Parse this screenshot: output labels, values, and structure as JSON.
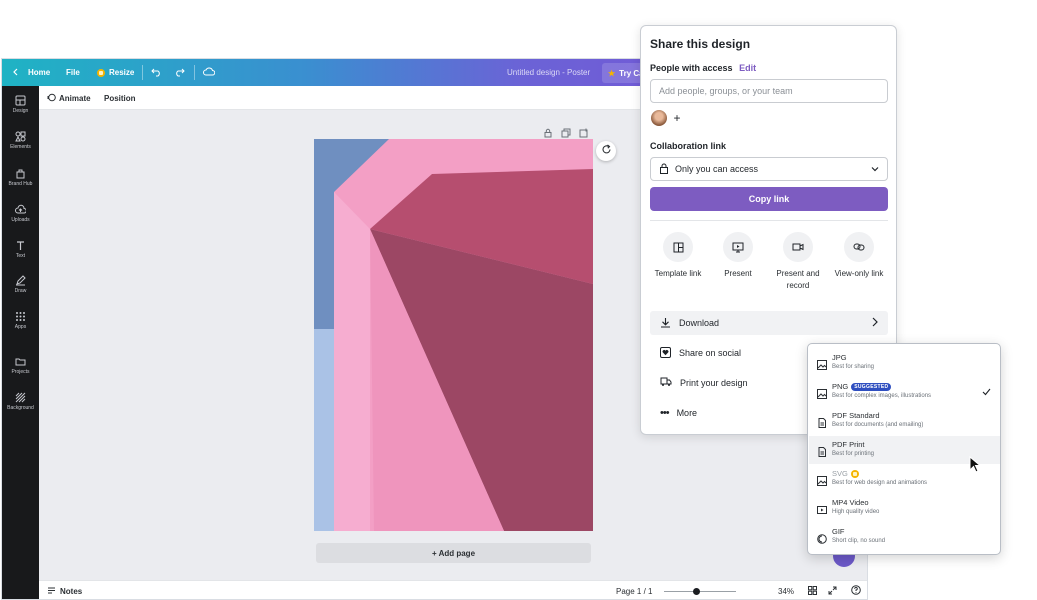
{
  "topbar": {
    "home": "Home",
    "file": "File",
    "resize": "Resize",
    "title": "Untitled design - Poster",
    "try": "Try Car"
  },
  "sidebar": {
    "items": [
      {
        "label": "Design",
        "icon": "layout-icon"
      },
      {
        "label": "Elements",
        "icon": "shapes-icon"
      },
      {
        "label": "Brand Hub",
        "icon": "brand-icon"
      },
      {
        "label": "Uploads",
        "icon": "cloud-upload-icon"
      },
      {
        "label": "Text",
        "icon": "text-icon"
      },
      {
        "label": "Draw",
        "icon": "pen-icon"
      },
      {
        "label": "Apps",
        "icon": "grid-icon"
      },
      {
        "label": "Projects",
        "icon": "folder-icon"
      },
      {
        "label": "Background",
        "icon": "pattern-icon"
      }
    ]
  },
  "context": {
    "animate": "Animate",
    "position": "Position"
  },
  "canvas": {
    "add_page": "+ Add page"
  },
  "bottombar": {
    "notes": "Notes",
    "page": "Page 1 / 1",
    "zoom": "34%",
    "zoom_level": 0.34
  },
  "share": {
    "title": "Share this design",
    "people_label": "People with access",
    "edit": "Edit",
    "input_placeholder": "Add people, groups, or your team",
    "collab_label": "Collaboration link",
    "access": "Only you can access",
    "copy_link": "Copy link",
    "options": [
      {
        "label": "Template link",
        "icon": "template-icon"
      },
      {
        "label": "Present",
        "icon": "present-icon"
      },
      {
        "label": "Present and record",
        "icon": "record-icon"
      },
      {
        "label": "View-only link",
        "icon": "link-icon"
      }
    ],
    "rows": [
      {
        "label": "Download",
        "icon": "download-icon"
      },
      {
        "label": "Share on social",
        "icon": "heart-icon"
      },
      {
        "label": "Print your design",
        "icon": "truck-icon"
      },
      {
        "label": "More",
        "icon": "more-icon"
      }
    ]
  },
  "download_menu": {
    "items": [
      {
        "name": "JPG",
        "desc": "Best for sharing",
        "icon": "image-icon"
      },
      {
        "name": "PNG",
        "badge": "SUGGESTED",
        "desc": "Best for complex images, illustrations",
        "icon": "image-icon",
        "selected": true
      },
      {
        "name": "PDF Standard",
        "desc": "Best for documents (and emailing)",
        "icon": "document-icon"
      },
      {
        "name": "PDF Print",
        "desc": "Best for printing",
        "icon": "document-icon",
        "hovered": true
      },
      {
        "name": "SVG",
        "desc": "Best for web design and animations",
        "icon": "image-icon",
        "premium": true
      },
      {
        "name": "MP4 Video",
        "desc": "High quality video",
        "icon": "video-icon"
      },
      {
        "name": "GIF",
        "desc": "Short clip, no sound",
        "icon": "gif-icon"
      }
    ]
  },
  "colors": {
    "accent": "#7d5cc1",
    "badge": "#2f4fc0",
    "sidebar": "#18191b",
    "poster_pink": "#f39fc5",
    "poster_dark": "#a84a68",
    "sky": "#7f9ec9"
  }
}
